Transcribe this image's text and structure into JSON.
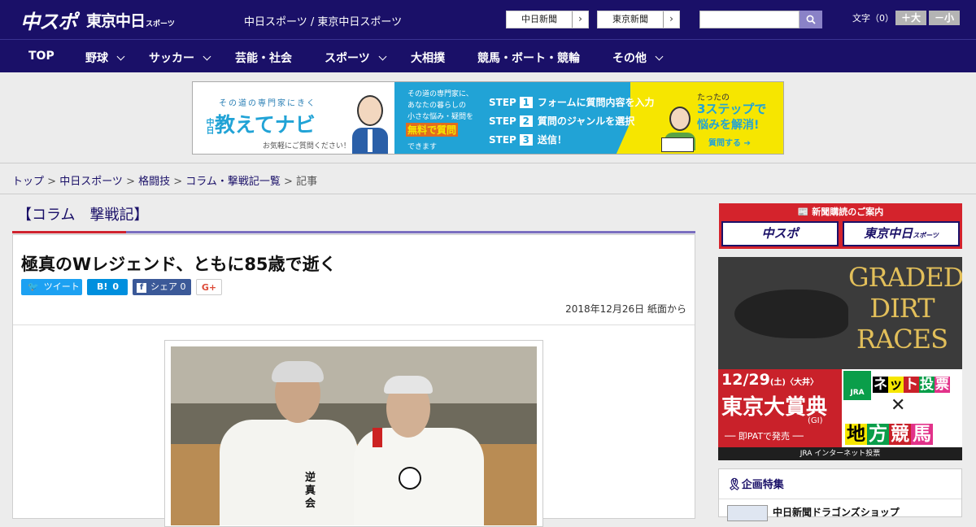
{
  "header": {
    "logo_main": "中スポ",
    "logo_tokyo": "東京中日",
    "logo_sports": "スポーツ",
    "site_title": "中日スポーツ / 東京中日スポーツ",
    "link_chunichi": "中日新聞",
    "link_tokyo": "東京新聞",
    "search_placeholder": "",
    "font_size_label": "文字（0）",
    "font_plus": "＋大",
    "font_minus": "－小"
  },
  "nav": {
    "items": [
      {
        "label": "TOP"
      },
      {
        "label": "野球"
      },
      {
        "label": "サッカー"
      },
      {
        "label": "芸能・社会"
      },
      {
        "label": "スポーツ"
      },
      {
        "label": "大相撲"
      },
      {
        "label": "競馬・ボート・競輪"
      },
      {
        "label": "その他"
      }
    ]
  },
  "banner": {
    "tagline": "その道の専門家にきく",
    "brand_small": "中日",
    "brand": "教えてナビ",
    "note": "お気軽にご質問ください！",
    "desc1": "その道の専門家に、",
    "desc2": "あなたの暮らしの",
    "desc3": "小さな悩み・疑問を",
    "free": "無料で質問",
    "desc4": "できます",
    "step1": "フォームに質問内容を入力",
    "step2": "質問のジャンルを選択",
    "step3": "送信！",
    "step_word": "STEP",
    "step1_n": "1",
    "step2_n": "2",
    "step3_n": "3",
    "right1": "たったの",
    "right2": "3ステップで",
    "right3": "悩みを解消!",
    "cta": "質問する"
  },
  "breadcrumb": {
    "items": [
      "トップ",
      "中日スポーツ",
      "格闘技",
      "コラム・撃戦記一覧"
    ],
    "current": "記事",
    "sep": " > "
  },
  "column": {
    "heading": "【コラム　撃戦記】"
  },
  "article": {
    "title": "極真のWレジェンド、ともに85歳で逝く",
    "tweet": "ツイート",
    "hatena": "B!",
    "hatena_count": "0",
    "share": "シェア",
    "share_count": "0",
    "gplus": "G+",
    "date": "2018年12月26日 紙面から",
    "gi1": "逆",
    "gi2": "真",
    "gi3": "会"
  },
  "sidebar": {
    "subscribe_head": "新聞購読のご案内",
    "sub_left": "中スポ",
    "sub_right": "東京中日",
    "sub_right_small": "スポーツ",
    "ad_title1": "GRADED",
    "ad_title2": "DIRT",
    "ad_title3": "RACES",
    "ad_date": "12/29",
    "ad_dow": "(土)",
    "ad_venue": "〈大井〉",
    "ad_race": "東京大賞典",
    "ad_grade": "(GI)",
    "ad_sale": "── 即PATで発売 ──",
    "ad_jra": "JRA",
    "ad_net1": "ネ",
    "ad_net2": "ッ",
    "ad_net3": "ト",
    "ad_net4": "投",
    "ad_net5": "票",
    "ad_local1": "地",
    "ad_local2": "方",
    "ad_local3": "競",
    "ad_local4": "馬",
    "ad_footer": "JRA インターネット投票",
    "feature_title": "企画特集",
    "feature_item": "中日新聞ドラゴンズショップ"
  },
  "colors": {
    "navy": "#1a1068",
    "red": "#d0232f",
    "purple": "#7b6fc0",
    "twitter": "#1da1f2",
    "hatena": "#008fde",
    "facebook": "#3b5998"
  }
}
